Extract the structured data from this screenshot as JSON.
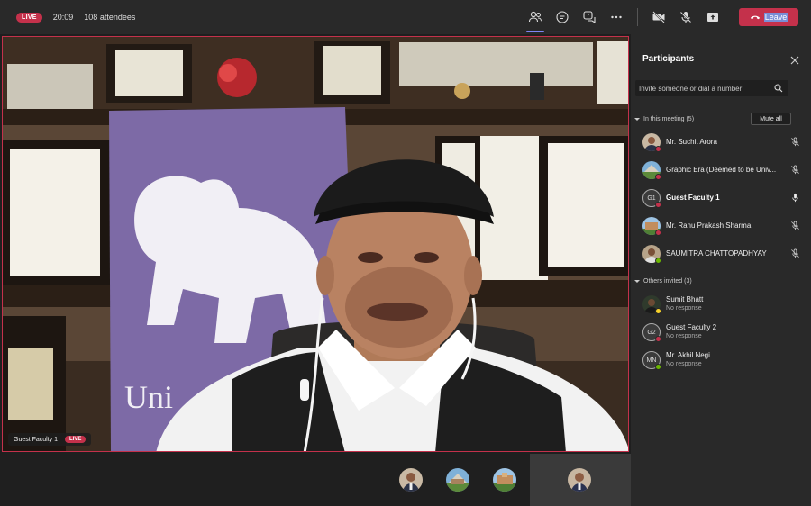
{
  "topbar": {
    "live_label": "LIVE",
    "timer": "20:09",
    "attendees": "108 attendees",
    "leave_label": "Leave",
    "icons": [
      "participants-icon",
      "chat-icon",
      "qa-icon",
      "more-icon",
      "camera-off-icon",
      "mic-off-icon",
      "share-icon"
    ]
  },
  "stage": {
    "name_tag": "Guest Faculty 1",
    "live_label": "LIVE"
  },
  "panel": {
    "title": "Participants",
    "invite_placeholder": "Invite someone or dial a number",
    "in_meeting_label": "In this meeting (5)",
    "mute_all_label": "Mute all",
    "in_meeting": [
      {
        "name": "Mr. Suchit Arora",
        "initials": "",
        "status": "busy",
        "mic": "muted",
        "bold": false
      },
      {
        "name": "Graphic Era (Deemed to be Univ...",
        "initials": "",
        "status": "busy",
        "mic": "muted",
        "bold": false
      },
      {
        "name": "Guest Faculty 1",
        "initials": "G1",
        "status": "busy",
        "mic": "on",
        "bold": true
      },
      {
        "name": "Mr. Ranu Prakash Sharma",
        "initials": "",
        "status": "busy",
        "mic": "muted",
        "bold": false
      },
      {
        "name": "SAUMITRA CHATTOPADHYAY",
        "initials": "",
        "status": "available",
        "mic": "muted",
        "bold": false
      }
    ],
    "others_label": "Others invited (3)",
    "others": [
      {
        "name": "Sumit Bhatt",
        "sub": "No response",
        "initials": "",
        "status": "away"
      },
      {
        "name": "Guest Faculty 2",
        "sub": "No response",
        "initials": "G2",
        "status": "busy"
      },
      {
        "name": "Mr. Akhil Negi",
        "sub": "No response",
        "initials": "MN",
        "status": "available"
      }
    ]
  },
  "colors": {
    "accent_red": "#c4314b",
    "accent_purple": "#7f85f5",
    "busy": "#c4314b",
    "available": "#6bb700",
    "away": "#f8d22a"
  }
}
